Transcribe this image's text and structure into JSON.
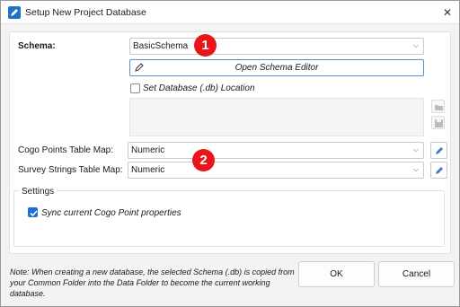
{
  "window": {
    "title": "Setup New Project Database",
    "close_glyph": "✕",
    "app_icon": "pencil-app-icon"
  },
  "schema": {
    "label": "Schema:",
    "value": "BasicSchema",
    "open_editor_label": "Open Schema Editor",
    "set_location_label": "Set Database (.db) Location",
    "set_location_checked": false
  },
  "maps": {
    "cogo_label": "Cogo Points Table Map:",
    "cogo_value": "Numeric",
    "survey_label": "Survey Strings Table Map:",
    "survey_value": "Numeric"
  },
  "settings": {
    "title": "Settings",
    "sync_label": "Sync current Cogo Point properties",
    "sync_checked": true
  },
  "annotations": {
    "badge_1": "1",
    "badge_2": "2",
    "badge_color": "#e8161b"
  },
  "footer": {
    "note": "Note: When creating a new database, the selected Schema (.db) is copied from your Common Folder into the Data Folder to become the current working database.",
    "ok_label": "OK",
    "cancel_label": "Cancel"
  },
  "icons": {
    "chevron": "chevron-down-icon",
    "edit": "pencil-icon",
    "folder": "folder-icon",
    "save": "save-icon"
  },
  "colors": {
    "accent": "#1e6fd0",
    "app_icon": "#1e73c8"
  }
}
